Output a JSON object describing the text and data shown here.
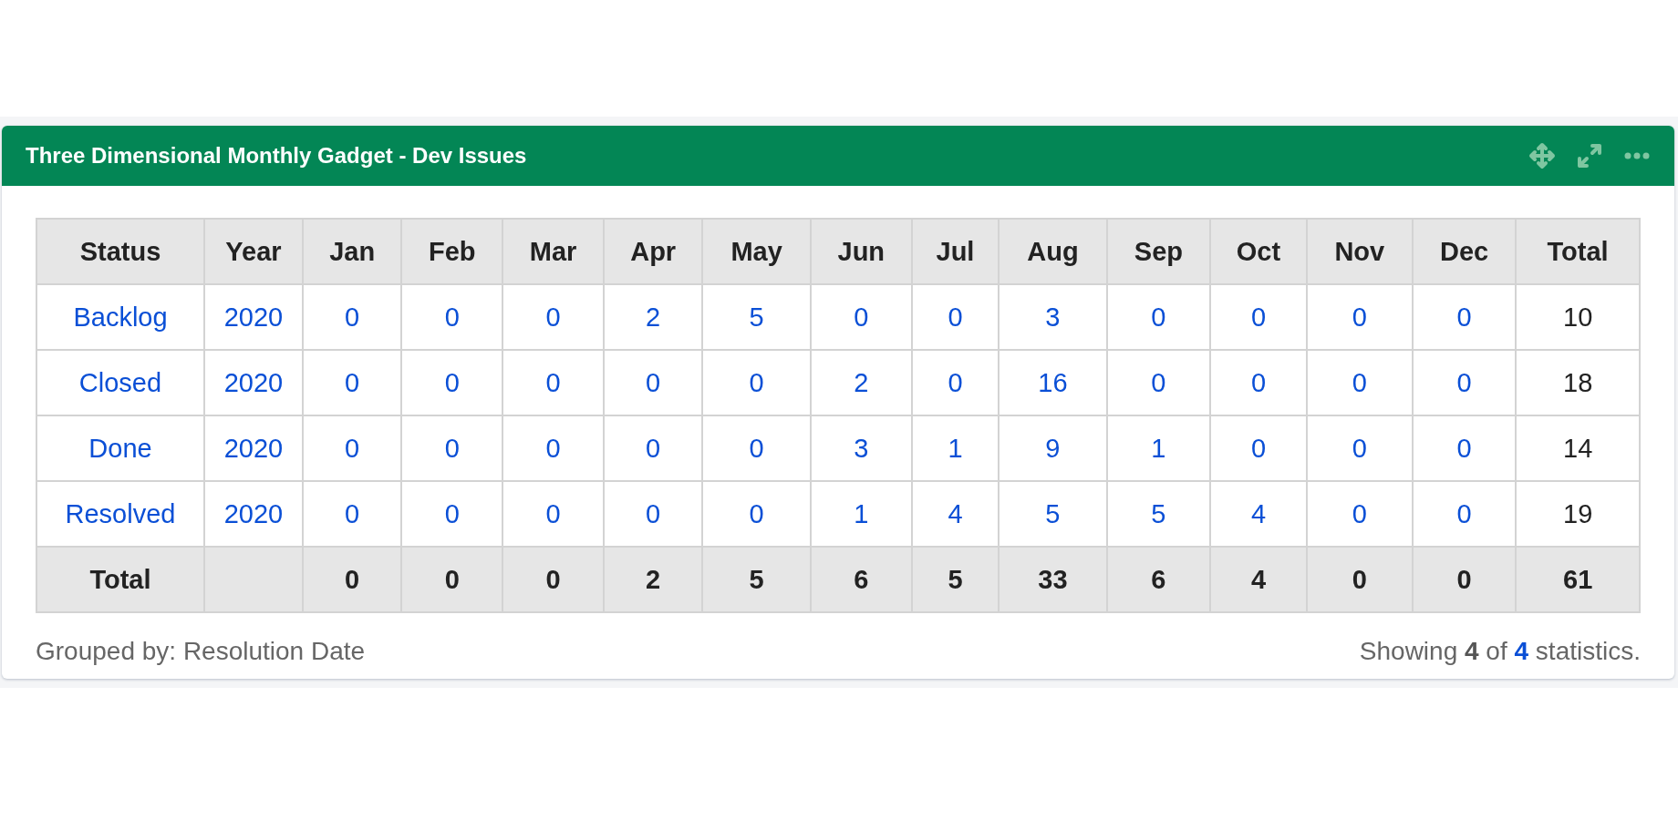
{
  "gadget": {
    "title": "Three Dimensional Monthly Gadget - Dev Issues"
  },
  "table": {
    "columns": [
      "Status",
      "Year",
      "Jan",
      "Feb",
      "Mar",
      "Apr",
      "May",
      "Jun",
      "Jul",
      "Aug",
      "Sep",
      "Oct",
      "Nov",
      "Dec",
      "Total"
    ],
    "rows": [
      {
        "status": "Backlog",
        "year": "2020",
        "months": [
          "0",
          "0",
          "0",
          "2",
          "5",
          "0",
          "0",
          "3",
          "0",
          "0",
          "0",
          "0"
        ],
        "total": "10"
      },
      {
        "status": "Closed",
        "year": "2020",
        "months": [
          "0",
          "0",
          "0",
          "0",
          "0",
          "2",
          "0",
          "16",
          "0",
          "0",
          "0",
          "0"
        ],
        "total": "18"
      },
      {
        "status": "Done",
        "year": "2020",
        "months": [
          "0",
          "0",
          "0",
          "0",
          "0",
          "3",
          "1",
          "9",
          "1",
          "0",
          "0",
          "0"
        ],
        "total": "14"
      },
      {
        "status": "Resolved",
        "year": "2020",
        "months": [
          "0",
          "0",
          "0",
          "0",
          "0",
          "1",
          "4",
          "5",
          "5",
          "4",
          "0",
          "0"
        ],
        "total": "19"
      }
    ],
    "totals": {
      "label": "Total",
      "months": [
        "0",
        "0",
        "0",
        "2",
        "5",
        "6",
        "5",
        "33",
        "6",
        "4",
        "0",
        "0"
      ],
      "total": "61"
    }
  },
  "footer": {
    "grouped_by": "Grouped by: Resolution Date",
    "summary": {
      "prefix": "Showing",
      "shown": "4",
      "middle": "of",
      "available": "4",
      "suffix": "statistics."
    }
  }
}
